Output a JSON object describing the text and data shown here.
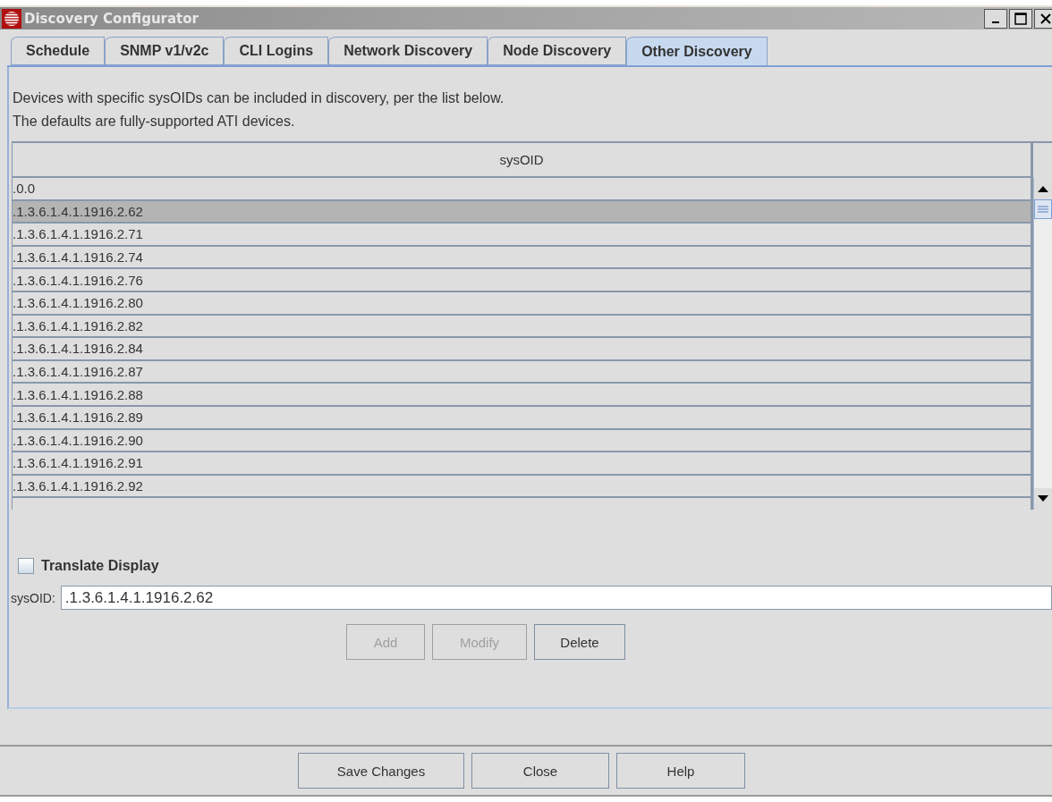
{
  "window": {
    "title": "Discovery Configurator"
  },
  "tabs": [
    {
      "label": "Schedule",
      "selected": false
    },
    {
      "label": "SNMP v1/v2c",
      "selected": false
    },
    {
      "label": "CLI Logins",
      "selected": false
    },
    {
      "label": "Network Discovery",
      "selected": false
    },
    {
      "label": "Node Discovery",
      "selected": false
    },
    {
      "label": "Other Discovery",
      "selected": true
    }
  ],
  "description": [
    "Devices with specific sysOIDs can be included in discovery, per the list below.",
    "The defaults are fully-supported ATI devices."
  ],
  "table": {
    "columns": [
      "sysOID"
    ],
    "rows": [
      {
        "cells": [
          ".0.0"
        ],
        "selected": false
      },
      {
        "cells": [
          ".1.3.6.1.4.1.1916.2.62"
        ],
        "selected": true
      },
      {
        "cells": [
          ".1.3.6.1.4.1.1916.2.71"
        ],
        "selected": false
      },
      {
        "cells": [
          ".1.3.6.1.4.1.1916.2.74"
        ],
        "selected": false
      },
      {
        "cells": [
          ".1.3.6.1.4.1.1916.2.76"
        ],
        "selected": false
      },
      {
        "cells": [
          ".1.3.6.1.4.1.1916.2.80"
        ],
        "selected": false
      },
      {
        "cells": [
          ".1.3.6.1.4.1.1916.2.82"
        ],
        "selected": false
      },
      {
        "cells": [
          ".1.3.6.1.4.1.1916.2.84"
        ],
        "selected": false
      },
      {
        "cells": [
          ".1.3.6.1.4.1.1916.2.87"
        ],
        "selected": false
      },
      {
        "cells": [
          ".1.3.6.1.4.1.1916.2.88"
        ],
        "selected": false
      },
      {
        "cells": [
          ".1.3.6.1.4.1.1916.2.89"
        ],
        "selected": false
      },
      {
        "cells": [
          ".1.3.6.1.4.1.1916.2.90"
        ],
        "selected": false
      },
      {
        "cells": [
          ".1.3.6.1.4.1.1916.2.91"
        ],
        "selected": false
      },
      {
        "cells": [
          ".1.3.6.1.4.1.1916.2.92"
        ],
        "selected": false
      }
    ]
  },
  "translate_display": {
    "label": "Translate Display",
    "checked": false
  },
  "sysoid_field": {
    "label": "sysOID:",
    "value": ".1.3.6.1.4.1.1916.2.62"
  },
  "list_buttons": [
    {
      "label": "Add",
      "disabled": true
    },
    {
      "label": "Modify",
      "disabled": true
    },
    {
      "label": "Delete",
      "disabled": false
    }
  ],
  "footer_buttons": [
    {
      "label": "Save Changes"
    },
    {
      "label": "Close"
    },
    {
      "label": "Help"
    }
  ]
}
